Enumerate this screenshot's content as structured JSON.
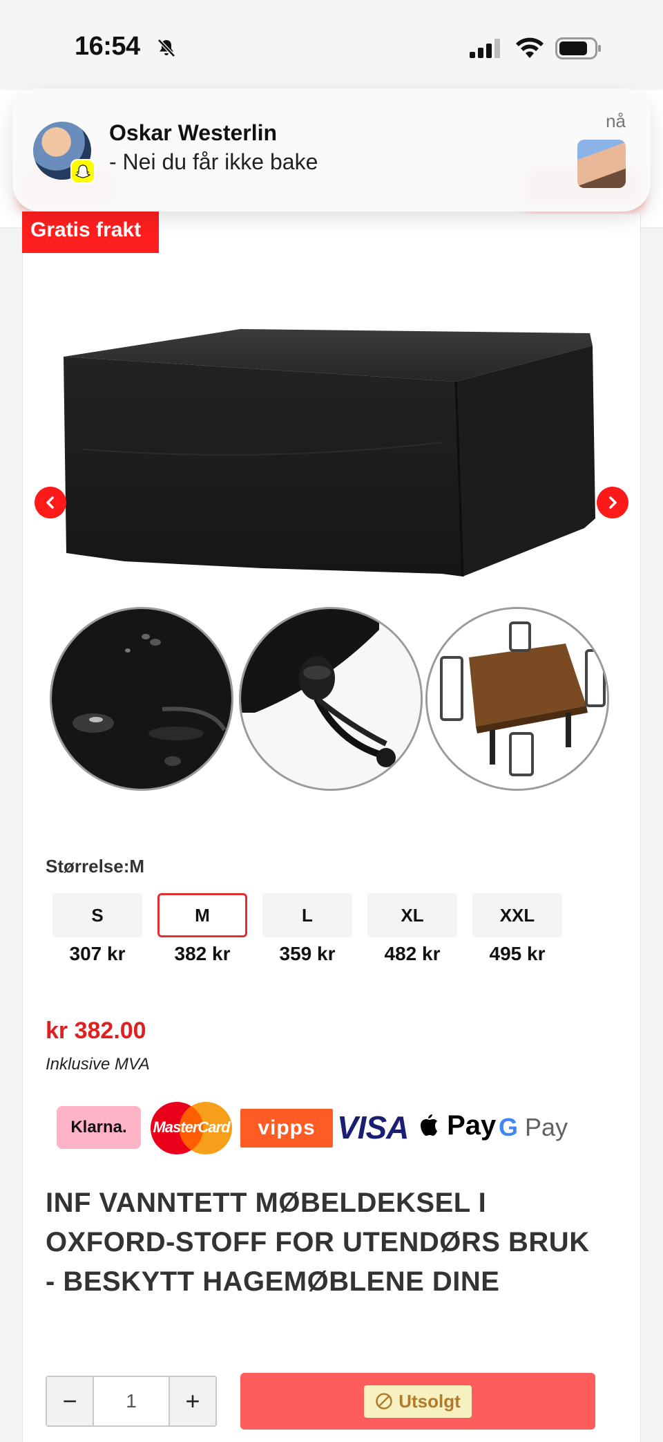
{
  "status_bar": {
    "time": "16:54"
  },
  "notification": {
    "app_icon": "snapchat-icon",
    "sender": "Oskar Westerlin",
    "message": "- Nei du får ikke bake",
    "time": "nå"
  },
  "product": {
    "badge": "Gratis frakt",
    "size_label": "Størrelse:M",
    "sizes": [
      {
        "label": "S",
        "price": "307 kr",
        "selected": false
      },
      {
        "label": "M",
        "price": "382 kr",
        "selected": true
      },
      {
        "label": "L",
        "price": "359 kr",
        "selected": false
      },
      {
        "label": "XL",
        "price": "482 kr",
        "selected": false
      },
      {
        "label": "XXL",
        "price": "495 kr",
        "selected": false
      }
    ],
    "price": "kr 382.00",
    "vat_note": "Inklusive MVA",
    "payment_methods": {
      "klarna": "Klarna.",
      "mastercard": "MasterCard",
      "vipps": "vipps",
      "visa": "VISA",
      "apple_pay": "Pay",
      "google_pay_g": "G",
      "google_pay": "Pay"
    },
    "title": "INF VANNTETT MØBELDEKSEL I OXFORD-STOFF FOR UTENDØRS BRUK - BESKYTT HAGEMØBLENE DINE",
    "quantity": "1",
    "qty_minus": "−",
    "qty_plus": "+",
    "soldout_label": "Utsolgt"
  },
  "colors": {
    "accent_red": "#ff1f1f",
    "price_red": "#e02020",
    "soldout_button": "#ff5c5c"
  }
}
